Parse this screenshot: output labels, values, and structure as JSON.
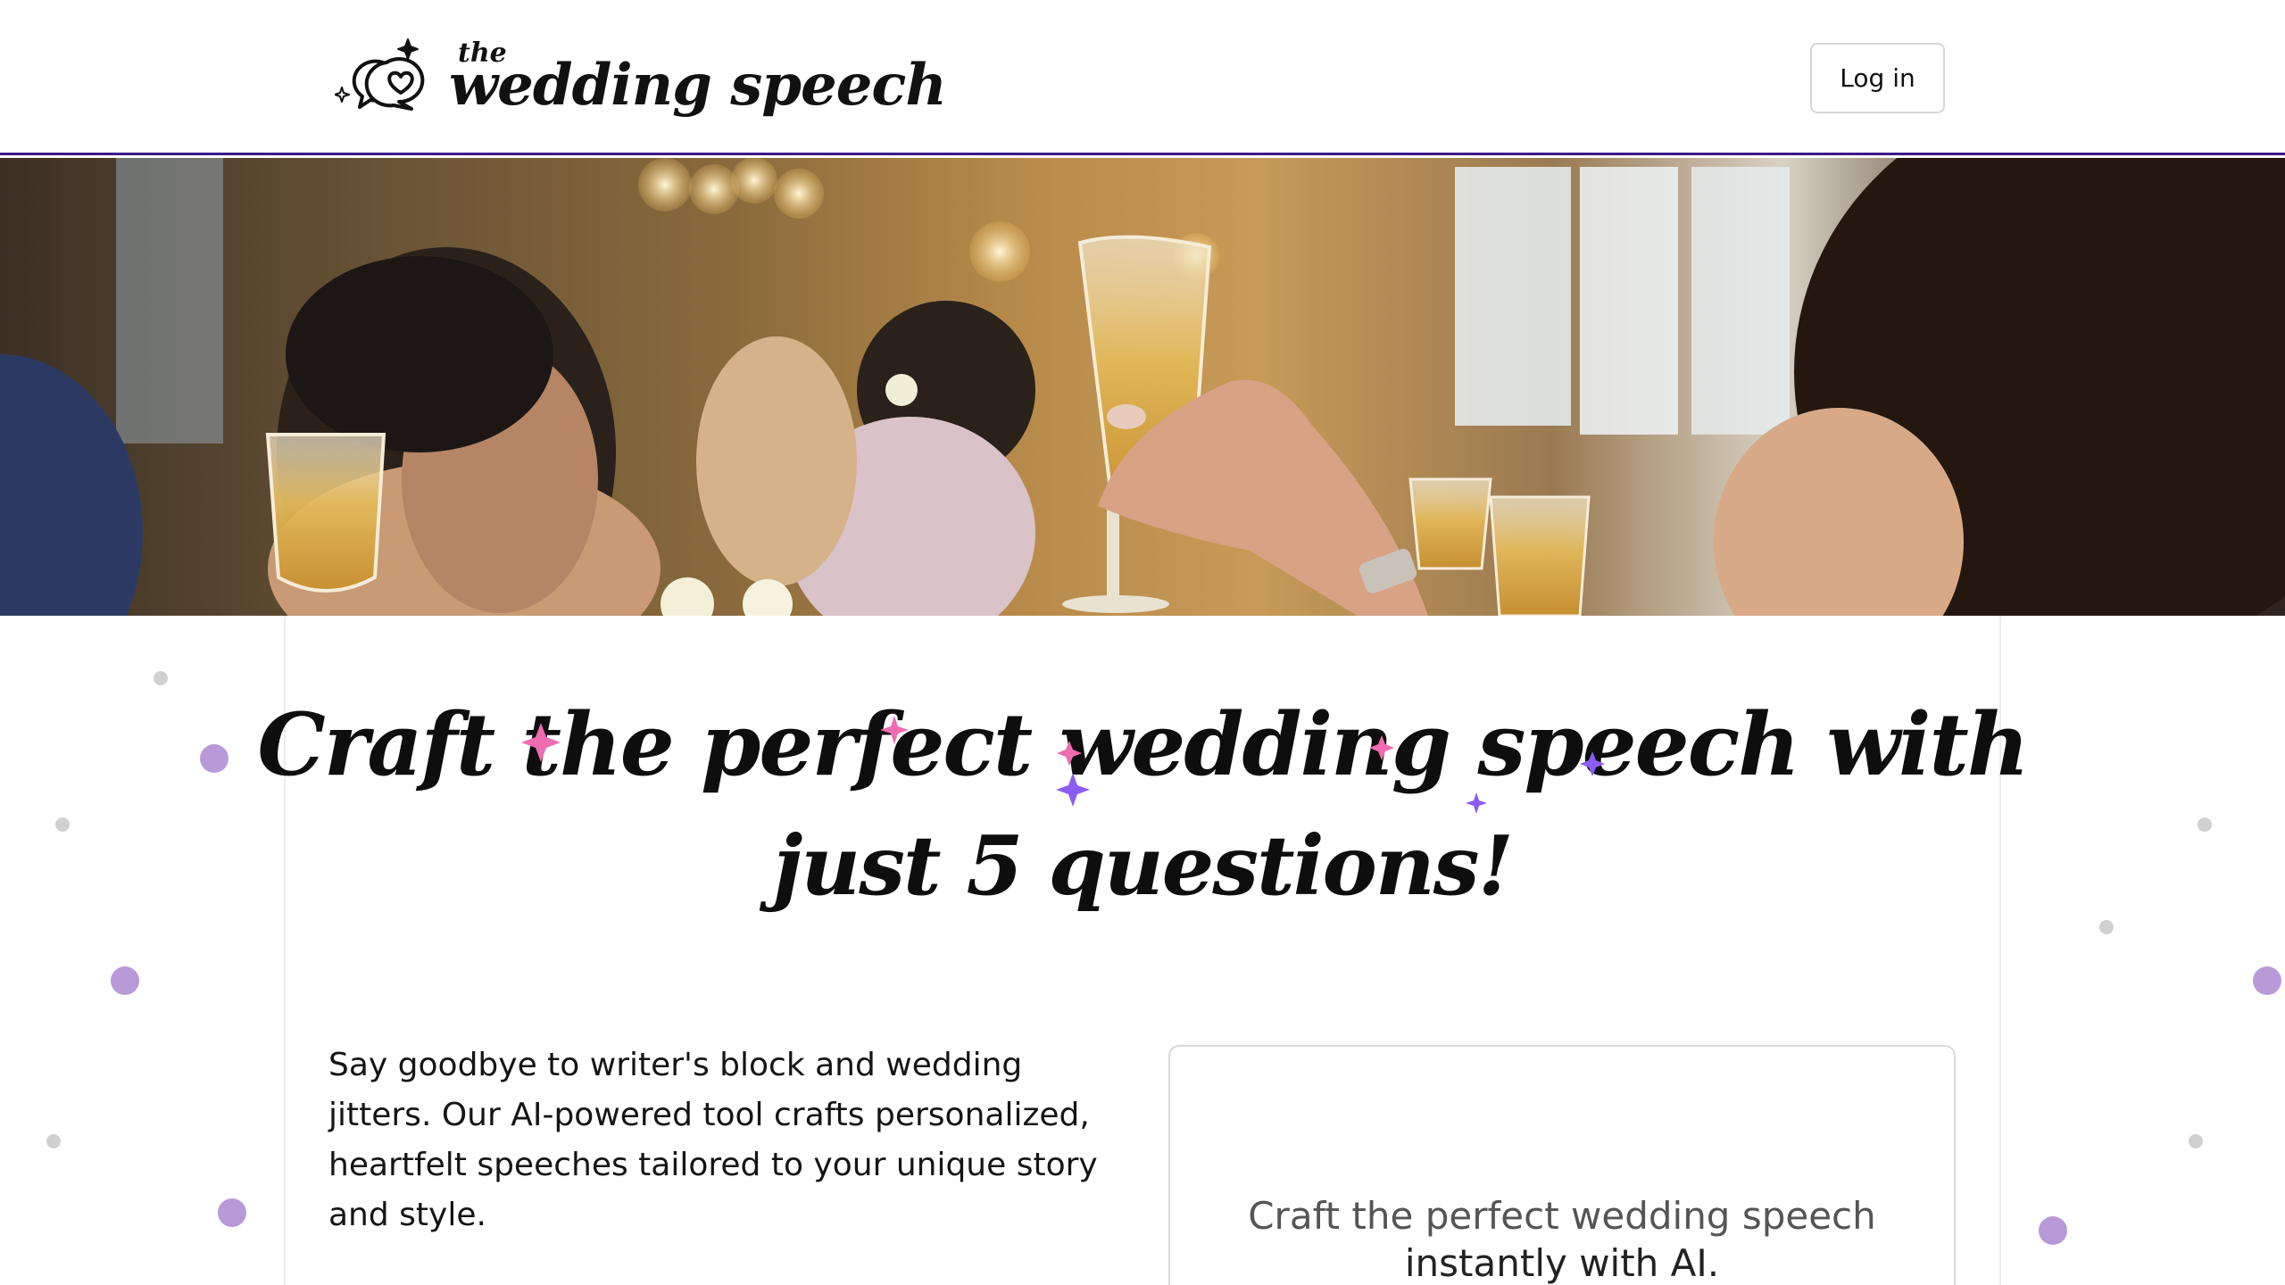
{
  "header": {
    "logo_small": "the",
    "logo_main": "wedding speech",
    "login_label": "Log in"
  },
  "hero": {
    "image_icon": "wedding-toast-photo"
  },
  "headline": {
    "line1": "Craft the perfect wedding speech with",
    "line2": "just 5 questions!"
  },
  "intro": {
    "text": "Say goodbye to writer's block and wedding jitters. Our AI-powered tool crafts personalized, heartfelt speeches tailored to your unique story and style."
  },
  "card": {
    "line1": "Craft the perfect wedding speech",
    "line2": "instantly with AI."
  },
  "colors": {
    "accent_purple": "#a154e8",
    "sparkle_pink": "#f06bb0",
    "sparkle_violet": "#8b5cf6",
    "dot_lavender": "#b89ad9",
    "dot_gray": "#d0d0d0",
    "header_border": "#3b1a8a"
  }
}
